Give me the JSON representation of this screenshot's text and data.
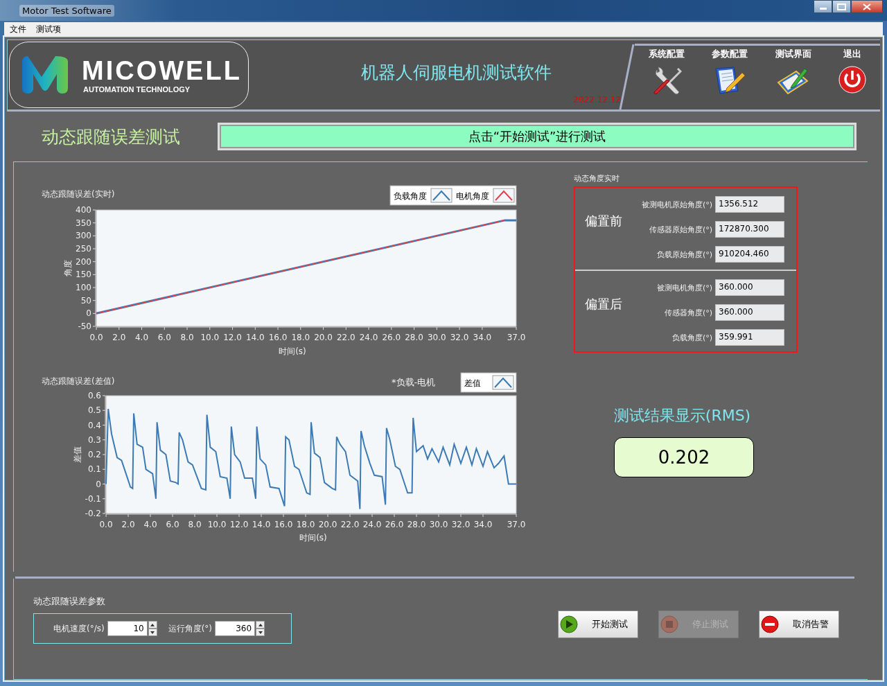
{
  "window": {
    "title": "Motor Test Software"
  },
  "menu": [
    "文件",
    "测试项"
  ],
  "header": {
    "logo": {
      "name": "MICOWELL",
      "tagline": "AUTOMATION TECHNOLOGY"
    },
    "title": "机器人伺服电机测试软件",
    "date": "2022.12.12",
    "nav": [
      {
        "label": "系统配置",
        "kind": "tools"
      },
      {
        "label": "参数配置",
        "kind": "notepad"
      },
      {
        "label": "测试界面",
        "kind": "tablet"
      },
      {
        "label": "退出",
        "kind": "power"
      }
    ]
  },
  "test": {
    "title": "动态跟随误差测试",
    "status": "点击“开始测试”进行测试"
  },
  "realtime_chart": {
    "title": "动态跟随误差(实时)",
    "chart_data": {
      "type": "line",
      "xlabel": "时间(s)",
      "ylabel": "角度",
      "x": [
        0,
        36,
        37
      ],
      "series": [
        {
          "name": "负载角度",
          "color": "#3b7ab4",
          "values": [
            0,
            360,
            360
          ]
        },
        {
          "name": "电机角度",
          "color": "#e8404a",
          "values": [
            0,
            360,
            null
          ]
        }
      ],
      "xlim": [
        0,
        37
      ],
      "ylim": [
        -50,
        400
      ],
      "xticks": [
        {
          "value": 0,
          "label": "0.0"
        },
        {
          "value": 2,
          "label": "2.0"
        },
        {
          "value": 4,
          "label": "4.0"
        },
        {
          "value": 6,
          "label": "6.0"
        },
        {
          "value": 8,
          "label": "8.0"
        },
        {
          "value": 10,
          "label": "10.0"
        },
        {
          "value": 12,
          "label": "12.0"
        },
        {
          "value": 14,
          "label": "14.0"
        },
        {
          "value": 16,
          "label": "16.0"
        },
        {
          "value": 18,
          "label": "18.0"
        },
        {
          "value": 20,
          "label": "20.0"
        },
        {
          "value": 22,
          "label": "22.0"
        },
        {
          "value": 24,
          "label": "24.0"
        },
        {
          "value": 26,
          "label": "26.0"
        },
        {
          "value": 28,
          "label": "28.0"
        },
        {
          "value": 30,
          "label": "30.0"
        },
        {
          "value": 32,
          "label": "32.0"
        },
        {
          "value": 34,
          "label": "34.0"
        },
        {
          "value": 37,
          "label": "37.0"
        }
      ],
      "yticks": [
        -50,
        0,
        50,
        100,
        150,
        200,
        250,
        300,
        350,
        400
      ],
      "legend": "top-right"
    }
  },
  "diff_chart": {
    "title": "动态跟随误差(差值)",
    "note": "*负载-电机",
    "chart_data": {
      "type": "line",
      "xlabel": "时间(s)",
      "ylabel": "差值",
      "x": [
        0,
        0.2,
        0.5,
        1.0,
        1.4,
        2.2,
        2.4,
        2.5,
        2.8,
        3.3,
        3.6,
        4.2,
        4.5,
        4.6,
        4.9,
        5.4,
        5.8,
        6.3,
        6.5,
        6.6,
        6.9,
        7.4,
        7.8,
        8.6,
        9.0,
        9.1,
        9.4,
        9.9,
        10.3,
        10.9,
        11.2,
        11.3,
        11.6,
        12.1,
        12.5,
        13.2,
        13.5,
        13.6,
        13.9,
        14.4,
        14.8,
        15.6,
        16.1,
        16.2,
        16.5,
        17.0,
        17.4,
        18.1,
        18.4,
        18.5,
        18.8,
        19.3,
        19.7,
        20.4,
        20.7,
        20.8,
        21.1,
        21.6,
        22.0,
        22.7,
        22.9,
        23.0,
        23.3,
        23.8,
        24.2,
        24.9,
        25.2,
        25.3,
        25.6,
        26.1,
        26.5,
        27.2,
        27.6,
        27.7,
        28.0,
        28.6,
        29.0,
        29.4,
        30.0,
        30.4,
        31.0,
        31.4,
        32.0,
        32.5,
        33.0,
        33.4,
        34.0,
        34.4,
        35.0,
        35.4,
        35.9,
        36.3,
        37.0
      ],
      "series": [
        {
          "name": "差值",
          "color": "#3b7ab4",
          "values": [
            0,
            0.51,
            0.34,
            0.18,
            0.16,
            -0.02,
            -0.03,
            0.48,
            0.27,
            0.25,
            0.1,
            0.07,
            -0.1,
            0.42,
            0.23,
            0.2,
            0.02,
            0.01,
            0.0,
            0.35,
            0.3,
            0.15,
            0.13,
            -0.03,
            -0.04,
            0.47,
            0.25,
            0.22,
            0.05,
            0.04,
            -0.1,
            0.39,
            0.2,
            0.15,
            0.04,
            0.04,
            -0.1,
            0.39,
            0.17,
            0.13,
            -0.02,
            -0.03,
            -0.15,
            0.32,
            0.3,
            0.12,
            0.1,
            -0.06,
            -0.07,
            0.42,
            0.21,
            0.18,
            0.01,
            -0.03,
            -0.04,
            0.32,
            0.27,
            0.22,
            0.06,
            0.02,
            -0.17,
            0.36,
            0.26,
            0.14,
            0.06,
            0.05,
            -0.14,
            0.38,
            0.3,
            0.12,
            0.1,
            -0.06,
            -0.06,
            0.45,
            0.22,
            0.26,
            0.17,
            0.24,
            0.15,
            0.25,
            0.13,
            0.27,
            0.14,
            0.25,
            0.13,
            0.24,
            0.12,
            0.22,
            0.11,
            0.14,
            0.19,
            0.0,
            0.0
          ]
        }
      ],
      "xlim": [
        0,
        37
      ],
      "ylim": [
        -0.2,
        0.6
      ],
      "xticks": [
        {
          "value": 0,
          "label": "0.0"
        },
        {
          "value": 2,
          "label": "2.0"
        },
        {
          "value": 4,
          "label": "4.0"
        },
        {
          "value": 6,
          "label": "6.0"
        },
        {
          "value": 8,
          "label": "8.0"
        },
        {
          "value": 10,
          "label": "10.0"
        },
        {
          "value": 12,
          "label": "12.0"
        },
        {
          "value": 14,
          "label": "14.0"
        },
        {
          "value": 16,
          "label": "16.0"
        },
        {
          "value": 18,
          "label": "18.0"
        },
        {
          "value": 20,
          "label": "20.0"
        },
        {
          "value": 22,
          "label": "22.0"
        },
        {
          "value": 24,
          "label": "24.0"
        },
        {
          "value": 26,
          "label": "26.0"
        },
        {
          "value": 28,
          "label": "28.0"
        },
        {
          "value": 30,
          "label": "30.0"
        },
        {
          "value": 32,
          "label": "32.0"
        },
        {
          "value": 34,
          "label": "34.0"
        },
        {
          "value": 37,
          "label": "37.0"
        }
      ],
      "yticks": [
        -0.2,
        -0.1,
        {
          "value": 0,
          "label": "0"
        },
        0.1,
        0.2,
        0.3,
        0.4,
        0.5,
        0.6
      ],
      "legend": "top-right"
    }
  },
  "angles": {
    "title": "动态角度实时",
    "groups": [
      {
        "label": "偏置前",
        "fields": [
          {
            "label": "被测电机原始角度(°)",
            "value": "1356.512"
          },
          {
            "label": "传感器原始角度(°)",
            "value": "172870.300"
          },
          {
            "label": "负载原始角度(°)",
            "value": "910204.460"
          }
        ]
      },
      {
        "label": "偏置后",
        "fields": [
          {
            "label": "被测电机角度(°)",
            "value": "360.000"
          },
          {
            "label": "传感器角度(°)",
            "value": "360.000"
          },
          {
            "label": "负载角度(°)",
            "value": "359.991"
          }
        ]
      }
    ]
  },
  "result": {
    "title": "测试结果显示(RMS)",
    "value": "0.202"
  },
  "params": {
    "title": "动态跟随误差参数",
    "fields": [
      {
        "label": "电机速度(°/s)",
        "value": "10"
      },
      {
        "label": "运行角度(°)",
        "value": "360"
      }
    ]
  },
  "buttons": [
    {
      "label": "开始测试",
      "kind": "start",
      "disabled": false
    },
    {
      "label": "停止测试",
      "kind": "stop",
      "disabled": true
    },
    {
      "label": "取消告警",
      "kind": "cancel",
      "disabled": false
    }
  ]
}
